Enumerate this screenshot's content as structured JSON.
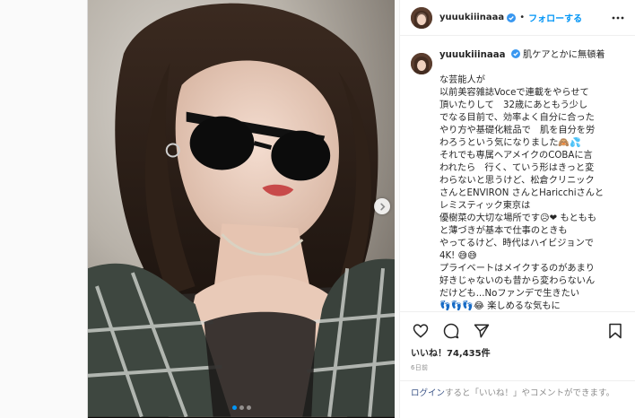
{
  "post": {
    "username": "yuuukiiinaaa",
    "follow_label": "フォローする",
    "separator": "•",
    "caption_lines": [
      "肌ケアとかに無頓着",
      "な芸能人が",
      "以前美容雑誌Voceで連載をやらせて",
      "頂いたりして　32歳にあともう少し",
      "でなる目前で、効率よく自分に合った",
      "やり方や基礎化粧品で　肌を自分を労",
      "わろうという気になりました🙈💦",
      "それでも専属ヘアメイクのCOBAに言",
      "われたら　行く、ていう形はきっと変",
      "わらないと思うけど、松倉クリニック",
      "さんとENVIRON さんとHaricchiさんと",
      "レミスティック東京は",
      "優樹菜の大切な場所です😥❤ もともも",
      "と薄づきが基本で仕事のときも",
      "やってるけど、時代はハイビジョンで",
      "4K! 😅😅",
      "プライベートはメイクするのがあまり",
      "好きじゃないのも昔から変わらないん",
      "だけども...Noファンデで生きたい",
      "👣👣👣😂 楽しめるな気もに"
    ],
    "likes_label": "いいね！74,435件",
    "time_label": "6日前",
    "login_link": "ログイン",
    "login_text": "すると「いいね！」やコメントができます。"
  },
  "carousel": {
    "dot_count": 3,
    "active_index": 0
  },
  "icons": {
    "next": "chevron-right-icon",
    "more": "more-horizontal-icon",
    "like": "heart-icon",
    "comment": "comment-icon",
    "share": "share-icon",
    "save": "bookmark-icon",
    "verified": "verified-badge-icon"
  },
  "colors": {
    "link": "#0095f6",
    "verified": "#3897f0",
    "login_link": "#385185"
  }
}
